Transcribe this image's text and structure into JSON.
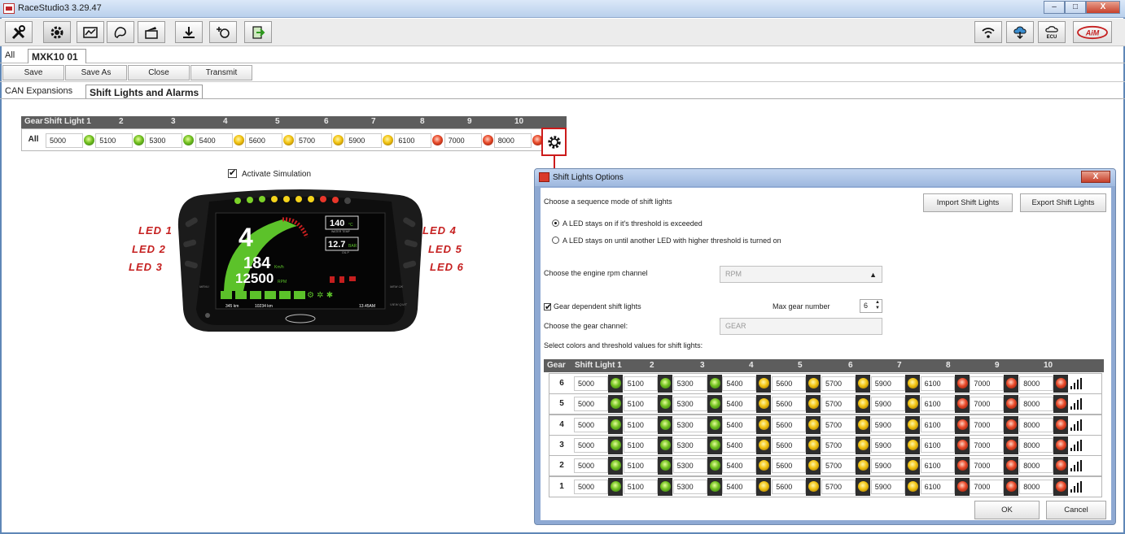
{
  "window": {
    "title": "RaceStudio3 3.29.47",
    "min": "–",
    "max": "□",
    "close": "X"
  },
  "toolbar": {
    "left_icons": [
      "tools-icon",
      "config-gear-icon",
      "dashboard-icon",
      "track-icon",
      "clapper-icon",
      "download-icon",
      "add-device-icon",
      "export-icon"
    ],
    "right_icons": [
      "wifi-icon",
      "cloud-download-icon",
      "ecu-cloud-icon",
      "aim-logo"
    ],
    "ecu_label": "ECU",
    "logo_text": "AiM"
  },
  "config_tabs": {
    "all": "All",
    "current": "MXK10 01",
    "close_glyph": "✂"
  },
  "actions": {
    "save": "Save",
    "save_as": "Save As",
    "close": "Close",
    "transmit": "Transmit"
  },
  "sub_tabs": {
    "can": "CAN Expansions",
    "shift": "Shift Lights and Alarms"
  },
  "shift_grid": {
    "headers": [
      "Gear",
      "Shift Light 1",
      "2",
      "3",
      "4",
      "5",
      "6",
      "7",
      "8",
      "9",
      "10"
    ],
    "row_label": "All",
    "values": [
      "5000",
      "5100",
      "5300",
      "5400",
      "5600",
      "5700",
      "5900",
      "6100",
      "7000",
      "8000"
    ],
    "colors": [
      "g",
      "g",
      "g",
      "y",
      "y",
      "y",
      "y",
      "r",
      "r",
      "r"
    ]
  },
  "simulation": {
    "label": "Activate Simulation",
    "checked": true
  },
  "dashboard": {
    "leds_left": [
      "LED 1",
      "LED 2",
      "LED 3"
    ],
    "leds_right": [
      "LED 4",
      "LED 5",
      "LED 6"
    ],
    "gear": "4",
    "speed": "184",
    "speed_unit": "Km/h",
    "rpm": "12500",
    "rpm_unit": "RPM",
    "water_temp": "140",
    "water_unit": "°C",
    "water_label": "WATER TEMP",
    "oil_press": "12.7",
    "oil_unit": "BAR",
    "oil_label": "OIL P",
    "odo1": "345 km",
    "odo2": "10234 km",
    "time": "13.45AM",
    "menu": "MENU",
    "memok": "MEM OK",
    "view": "VIEW QUIT"
  },
  "dialog": {
    "title": "Shift Lights Options",
    "sequence_prompt": "Choose a sequence mode of shift lights",
    "import_btn": "Import Shift Lights",
    "export_btn": "Export Shift Lights",
    "mode1": "A LED stays on if it's threshold is exceeded",
    "mode2": "A LED stays on until another LED with higher threshold is turned on",
    "rpm_prompt": "Choose the engine rpm channel",
    "rpm_value": "RPM",
    "gear_dependent": "Gear dependent shift lights",
    "max_gear_label": "Max gear number",
    "max_gear_value": "6",
    "gear_channel_label": "Choose the gear channel:",
    "gear_channel_value": "GEAR",
    "select_prompt": "Select colors and threshold values for shift lights:",
    "headers": [
      "Gear",
      "Shift Light 1",
      "2",
      "3",
      "4",
      "5",
      "6",
      "7",
      "8",
      "9",
      "10"
    ],
    "rows": [
      {
        "gear": "6",
        "values": [
          "5000",
          "5100",
          "5300",
          "5400",
          "5600",
          "5700",
          "5900",
          "6100",
          "7000",
          "8000"
        ]
      },
      {
        "gear": "5",
        "values": [
          "5000",
          "5100",
          "5300",
          "5400",
          "5600",
          "5700",
          "5900",
          "6100",
          "7000",
          "8000"
        ]
      },
      {
        "gear": "4",
        "values": [
          "5000",
          "5100",
          "5300",
          "5400",
          "5600",
          "5700",
          "5900",
          "6100",
          "7000",
          "8000"
        ]
      },
      {
        "gear": "3",
        "values": [
          "5000",
          "5100",
          "5300",
          "5400",
          "5600",
          "5700",
          "5900",
          "6100",
          "7000",
          "8000"
        ]
      },
      {
        "gear": "2",
        "values": [
          "5000",
          "5100",
          "5300",
          "5400",
          "5600",
          "5700",
          "5900",
          "6100",
          "7000",
          "8000"
        ]
      },
      {
        "gear": "1",
        "values": [
          "5000",
          "5100",
          "5300",
          "5400",
          "5600",
          "5700",
          "5900",
          "6100",
          "7000",
          "8000"
        ]
      }
    ],
    "colors": [
      "g",
      "g",
      "g",
      "y",
      "y",
      "y",
      "y",
      "r",
      "r",
      "r"
    ],
    "ok": "OK",
    "cancel": "Cancel"
  }
}
